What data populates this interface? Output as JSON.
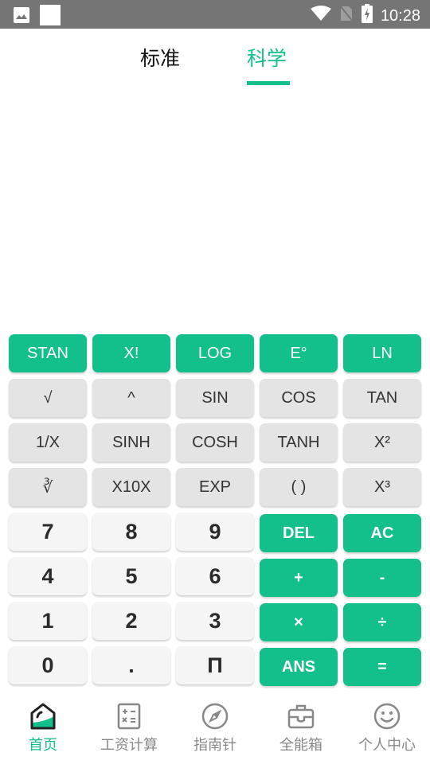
{
  "status_bar": {
    "time": "10:28",
    "icons": [
      "image-icon",
      "square-icon",
      "wifi-icon",
      "no-sim-icon",
      "battery-charging-icon"
    ]
  },
  "tabs": [
    {
      "label": "标准",
      "active": false
    },
    {
      "label": "科学",
      "active": true
    }
  ],
  "colors": {
    "accent": "#13bf8a",
    "key_gray": "#e4e4e4",
    "key_light": "#f5f5f5",
    "status_bar": "#757575"
  },
  "display": {
    "expression": "",
    "result": ""
  },
  "keypad": {
    "rows": [
      [
        {
          "label": "STAN",
          "style": "green"
        },
        {
          "label": "X!",
          "style": "green"
        },
        {
          "label": "LOG",
          "style": "green"
        },
        {
          "label": "E°",
          "style": "green"
        },
        {
          "label": "LN",
          "style": "green"
        }
      ],
      [
        {
          "label": "√",
          "style": "gray"
        },
        {
          "label": "^",
          "style": "gray"
        },
        {
          "label": "SIN",
          "style": "gray"
        },
        {
          "label": "COS",
          "style": "gray"
        },
        {
          "label": "TAN",
          "style": "gray"
        }
      ],
      [
        {
          "label": "1/X",
          "style": "gray"
        },
        {
          "label": "SINH",
          "style": "gray"
        },
        {
          "label": "COSH",
          "style": "gray"
        },
        {
          "label": "TANH",
          "style": "gray"
        },
        {
          "label": "X²",
          "style": "gray"
        }
      ],
      [
        {
          "label": "∛",
          "style": "gray"
        },
        {
          "label": "X10X",
          "style": "gray"
        },
        {
          "label": "EXP",
          "style": "gray"
        },
        {
          "label": "( )",
          "style": "gray"
        },
        {
          "label": "X³",
          "style": "gray"
        }
      ],
      [
        {
          "label": "7",
          "style": "light"
        },
        {
          "label": "8",
          "style": "light"
        },
        {
          "label": "9",
          "style": "light"
        },
        {
          "label": "DEL",
          "style": "green bold"
        },
        {
          "label": "AC",
          "style": "green bold"
        }
      ],
      [
        {
          "label": "4",
          "style": "light"
        },
        {
          "label": "5",
          "style": "light"
        },
        {
          "label": "6",
          "style": "light"
        },
        {
          "label": "+",
          "style": "green bold"
        },
        {
          "label": "-",
          "style": "green bold"
        }
      ],
      [
        {
          "label": "1",
          "style": "light"
        },
        {
          "label": "2",
          "style": "light"
        },
        {
          "label": "3",
          "style": "light"
        },
        {
          "label": "×",
          "style": "green bold"
        },
        {
          "label": "÷",
          "style": "green bold"
        }
      ],
      [
        {
          "label": "0",
          "style": "light"
        },
        {
          "label": ".",
          "style": "light"
        },
        {
          "label": "Π",
          "style": "light"
        },
        {
          "label": "ANS",
          "style": "green bold"
        },
        {
          "label": "=",
          "style": "green bold"
        }
      ]
    ]
  },
  "bottom_nav": [
    {
      "label": "首页",
      "icon": "home-icon",
      "active": true
    },
    {
      "label": "工资计算",
      "icon": "calculator-icon",
      "active": false
    },
    {
      "label": "指南针",
      "icon": "compass-icon",
      "active": false
    },
    {
      "label": "全能箱",
      "icon": "toolbox-icon",
      "active": false
    },
    {
      "label": "个人中心",
      "icon": "smiley-icon",
      "active": false
    }
  ]
}
